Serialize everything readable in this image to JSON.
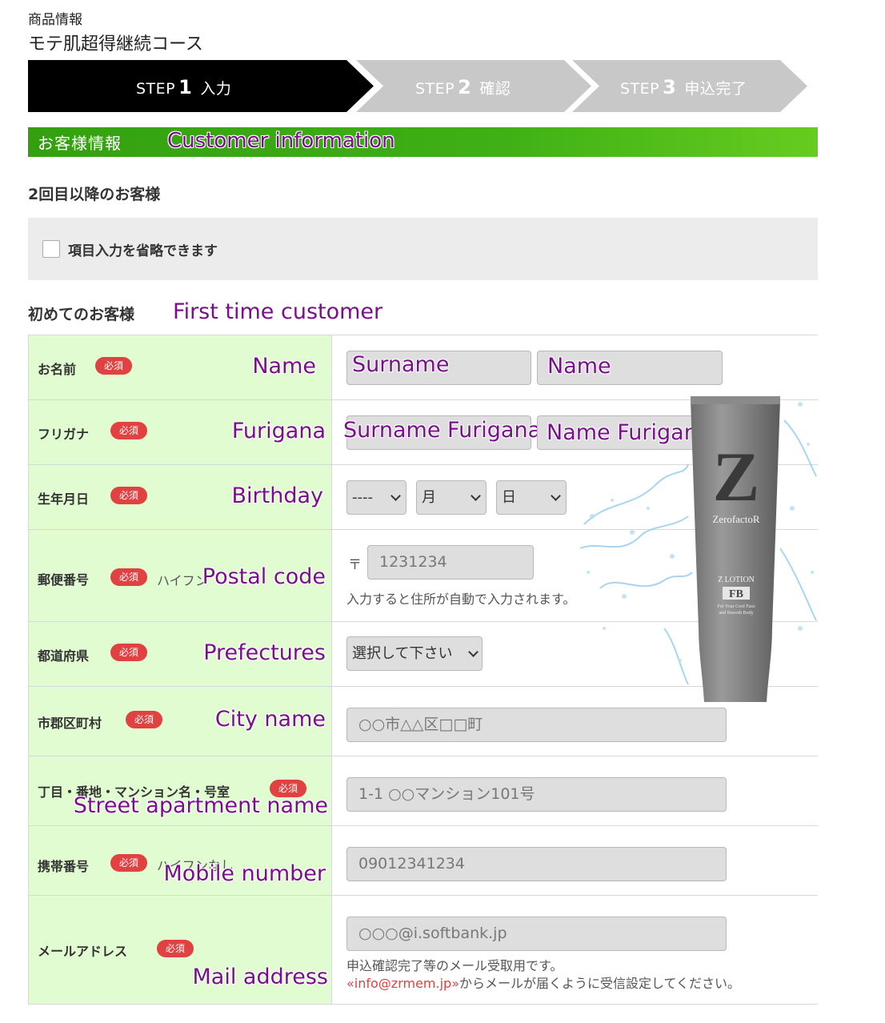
{
  "product": {
    "label": "商品情報",
    "name": "モテ肌超得継続コース"
  },
  "steps": [
    {
      "prefix": "STEP",
      "num": "1",
      "label": "入力"
    },
    {
      "prefix": "STEP",
      "num": "2",
      "label": "確認"
    },
    {
      "prefix": "STEP",
      "num": "3",
      "label": "申込完了"
    }
  ],
  "section": {
    "title": "お客様情報",
    "overlay": "Customer information"
  },
  "returning": {
    "title": "2回目以降のお客様",
    "checkbox_label": "項目入力を省略できます"
  },
  "first_time": {
    "title": "初めてのお客様",
    "overlay": "First time customer"
  },
  "required_badge": "必須",
  "rows": {
    "name": {
      "label": "お名前",
      "overlay": "Name",
      "input1": "Surname",
      "input2": "Name"
    },
    "furigana": {
      "label": "フリガナ",
      "overlay": "Furigana",
      "input1": "Surname Furigana",
      "input2": "Name Furigana"
    },
    "birthday": {
      "label": "生年月日",
      "overlay": "Birthday",
      "year": "----",
      "month": "月",
      "day": "日"
    },
    "postal": {
      "label": "郵便番号",
      "note": "ハイフン",
      "overlay": "Postal code",
      "prefix": "〒",
      "placeholder": "1231234",
      "help": "入力すると住所が自動で入力されます。"
    },
    "prefecture": {
      "label": "都道府県",
      "overlay": "Prefectures",
      "selected": "選択して下さい"
    },
    "city": {
      "label": "市郡区町村",
      "overlay": "City name",
      "placeholder": "○○市△△区□□町"
    },
    "street": {
      "label": "丁目・番地・マンション名・号室",
      "overlay": "Street apartment name",
      "placeholder": "1-1 ○○マンション101号"
    },
    "mobile": {
      "label": "携帯番号",
      "note": "ハイフンなし",
      "overlay": "Mobile number",
      "placeholder": "09012341234"
    },
    "email": {
      "label": "メールアドレス",
      "overlay": "Mail address",
      "placeholder": "○○○@i.softbank.jp",
      "help1": "申込確認完了等のメール受取用です。",
      "help2_link": "«info@zrmem.jp»",
      "help2_rest": "からメールが届くように受信設定してください。"
    }
  },
  "product_image": {
    "brand": "ZerofactoR",
    "line1": "Z LOTION",
    "line2": "FB",
    "line3": "For Your Cool Face",
    "line4": "and Smooth Body"
  },
  "colors": {
    "step_active": "#000000",
    "step_inactive": "#c8c8c8",
    "section_green": "#3fb015",
    "label_bg": "#e2fcd2",
    "required": "#e04141",
    "overlay_text": "#7a0f8c"
  }
}
